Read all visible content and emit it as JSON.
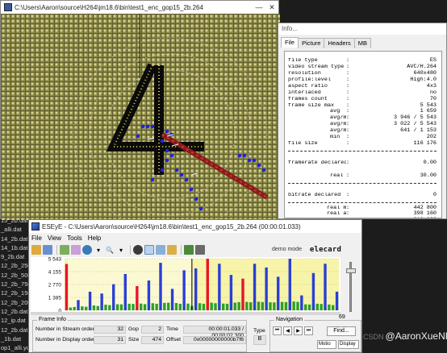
{
  "file_strip": [
    "15_2b.dat",
    "_alli.dat",
    "14_2b.dat",
    "14_1b.dat",
    "9_2b.dat",
    "12_2b_250k.",
    "12_2b_500k.",
    "12_2b_750k.",
    "12_2b_1500",
    "12_2b_2000",
    "12_2b.dat",
    "12_ip.dat",
    "12_2b.dat",
    "_1b.dat",
    "op1_alli.yuv"
  ],
  "video_window": {
    "title": "C:\\Users\\Aaron\\source\\H264\\jm18.6\\bin\\test1_enc_gop15_2b.264",
    "controls": [
      "—",
      "✕"
    ]
  },
  "info_window": {
    "title": "Info...",
    "tabs": [
      "File",
      "Picture",
      "Headers",
      "MB"
    ],
    "rows": [
      {
        "k": "file type",
        "v": "ES"
      },
      {
        "k": "video stream type",
        "v": "AVC/H.264"
      },
      {
        "k": "resolution",
        "v": "640x480"
      },
      {
        "k": "profile:level",
        "v": "High:4.0"
      },
      {
        "k": "aspect ratio",
        "v": "4x3"
      },
      {
        "k": "interlaced",
        "v": "no"
      },
      {
        "k": "frames count",
        "v": "70"
      },
      {
        "k": "frame size max",
        "v": "5 543"
      },
      {
        "k": "avg",
        "v": "1 659"
      },
      {
        "k": "avg/max (I)",
        "v": "3 946 / 5 543"
      },
      {
        "k": "avg/max (P)",
        "v": "3 022 / 5 543"
      },
      {
        "k": "avg/max (B)",
        "v": "641 / 1 153"
      },
      {
        "k": "min",
        "v": "202"
      },
      {
        "k": "file size",
        "v": "116 176"
      },
      {
        "k": "framerate declared",
        "v": "0.00"
      },
      {
        "k": "real",
        "v": "30.00"
      },
      {
        "k": "bitrate declared",
        "v": "0"
      },
      {
        "k": "real max",
        "v": "442 800"
      },
      {
        "k": "real avg",
        "v": "398 160"
      },
      {
        "k": "real min",
        "v": "310 080"
      }
    ]
  },
  "eseye_window": {
    "title": "ESEyE - C:\\Users\\Aaron\\source\\H264\\jm18.6\\bin\\test1_enc_gop15_2b.264 (00:00:01.033)",
    "menu": [
      "File",
      "View",
      "Tools",
      "Help"
    ],
    "demo_mode": "demo mode",
    "logo": "elecard",
    "frame_slider_value": "69",
    "frame_info": {
      "legend": "Frame Info",
      "stream_order_label": "Number in Stream order",
      "stream_order_value": "32",
      "display_order_label": "Number in Display order",
      "display_order_value": "31",
      "gop_label": "Gop",
      "gop_value": "2",
      "size_label": "Size",
      "size_value": "474",
      "time_label": "Time",
      "time_value": "00:00:01.033 / 00:00:02.300",
      "offset_label": "Offset",
      "offset_value": "0x00000000000b7f6",
      "type_label": "Type",
      "type_value": "B"
    },
    "navigation": {
      "legend": "Navigation",
      "find_label": "Find...",
      "mode_value": "Motio",
      "display_value": "Display"
    }
  },
  "watermark": {
    "prefix": "CSDN",
    "text": "@AaronXueNF"
  },
  "chart_data": {
    "type": "bar",
    "title": "",
    "ylabel": "",
    "yticks": [
      "5 543",
      "4 155",
      "2 770",
      "1 385",
      "0"
    ],
    "ylim": [
      0,
      5543
    ],
    "colors": {
      "I": "#e8142a",
      "P": "#2a3fd6",
      "B": "#2aa12a"
    },
    "frames": [
      {
        "t": "I",
        "v": 4980
      },
      {
        "t": "B",
        "v": 300
      },
      {
        "t": "B",
        "v": 360
      },
      {
        "t": "P",
        "v": 1100
      },
      {
        "t": "B",
        "v": 420
      },
      {
        "t": "B",
        "v": 380
      },
      {
        "t": "P",
        "v": 2000
      },
      {
        "t": "B",
        "v": 520
      },
      {
        "t": "B",
        "v": 460
      },
      {
        "t": "P",
        "v": 1800
      },
      {
        "t": "B",
        "v": 600
      },
      {
        "t": "B",
        "v": 560
      },
      {
        "t": "P",
        "v": 2800
      },
      {
        "t": "B",
        "v": 650
      },
      {
        "t": "B",
        "v": 640
      },
      {
        "t": "P",
        "v": 3900
      },
      {
        "t": "B",
        "v": 700
      },
      {
        "t": "B",
        "v": 680
      },
      {
        "t": "I",
        "v": 2600
      },
      {
        "t": "B",
        "v": 720
      },
      {
        "t": "B",
        "v": 660
      },
      {
        "t": "P",
        "v": 3200
      },
      {
        "t": "B",
        "v": 760
      },
      {
        "t": "B",
        "v": 700
      },
      {
        "t": "P",
        "v": 5100
      },
      {
        "t": "B",
        "v": 800
      },
      {
        "t": "B",
        "v": 820
      },
      {
        "t": "P",
        "v": 2300
      },
      {
        "t": "B",
        "v": 780
      },
      {
        "t": "B",
        "v": 700
      },
      {
        "t": "P",
        "v": 4300
      },
      {
        "t": "B",
        "v": 720
      },
      {
        "t": "B",
        "v": 474
      },
      {
        "t": "P",
        "v": 4500
      },
      {
        "t": "B",
        "v": 760
      },
      {
        "t": "B",
        "v": 700
      },
      {
        "t": "I",
        "v": 5543
      },
      {
        "t": "B",
        "v": 820
      },
      {
        "t": "B",
        "v": 760
      },
      {
        "t": "P",
        "v": 5000
      },
      {
        "t": "B",
        "v": 720
      },
      {
        "t": "B",
        "v": 700
      },
      {
        "t": "P",
        "v": 3800
      },
      {
        "t": "B",
        "v": 820
      },
      {
        "t": "B",
        "v": 880
      },
      {
        "t": "I",
        "v": 3400
      },
      {
        "t": "B",
        "v": 900
      },
      {
        "t": "B",
        "v": 860
      },
      {
        "t": "P",
        "v": 5000
      },
      {
        "t": "B",
        "v": 920
      },
      {
        "t": "B",
        "v": 880
      },
      {
        "t": "P",
        "v": 4600
      },
      {
        "t": "B",
        "v": 860
      },
      {
        "t": "B",
        "v": 840
      },
      {
        "t": "P",
        "v": 3600
      },
      {
        "t": "B",
        "v": 900
      },
      {
        "t": "B",
        "v": 880
      },
      {
        "t": "P",
        "v": 5543
      },
      {
        "t": "B",
        "v": 940
      },
      {
        "t": "B",
        "v": 900
      },
      {
        "t": "P",
        "v": 1600
      },
      {
        "t": "B",
        "v": 640
      },
      {
        "t": "B",
        "v": 620
      },
      {
        "t": "P",
        "v": 4000
      },
      {
        "t": "B",
        "v": 700
      },
      {
        "t": "B",
        "v": 680
      },
      {
        "t": "P",
        "v": 5000
      },
      {
        "t": "B",
        "v": 620
      },
      {
        "t": "B",
        "v": 560
      },
      {
        "t": "P",
        "v": 2000
      }
    ],
    "current_frame": 32
  }
}
